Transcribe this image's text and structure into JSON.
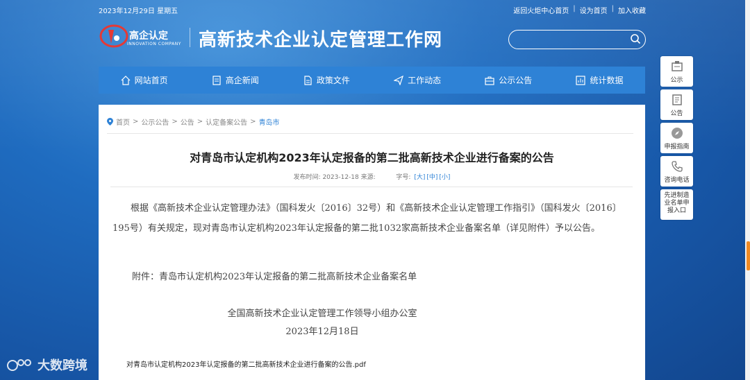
{
  "topbar": {
    "date": "2023年12月29日 星期五",
    "links": [
      "返回火炬中心首页",
      "设为首页",
      "加入收藏"
    ]
  },
  "logo": {
    "text": "高企认定",
    "sub": "INNOVATION COMPANY"
  },
  "site_title": "高新技术企业认定管理工作网",
  "search": {
    "placeholder": "",
    "icon": "search-icon"
  },
  "nav": [
    {
      "label": "网站首页",
      "icon": "home-icon"
    },
    {
      "label": "高企新闻",
      "icon": "news-icon"
    },
    {
      "label": "政策文件",
      "icon": "document-icon"
    },
    {
      "label": "工作动态",
      "icon": "send-icon"
    },
    {
      "label": "公示公告",
      "icon": "briefcase-icon"
    },
    {
      "label": "统计数据",
      "icon": "chart-icon"
    }
  ],
  "breadcrumb": [
    "首页",
    "公示公告",
    "公告",
    "认定备案公告",
    "青岛市"
  ],
  "article": {
    "title": "对青岛市认定机构2023年认定报备的第二批高新技术企业进行备案的公告",
    "meta_date_label": "发布时间: 2023-12-18 来源:",
    "meta_font_label": "字号:",
    "font_sizes": [
      "[大]",
      "[中]",
      "[小]"
    ],
    "body": "根据《高新技术企业认定管理办法》（国科发火〔2016〕32号）和《高新技术企业认定管理工作指引》（国科发火〔2016〕195号）有关规定，现对青岛市认定机构2023年认定报备的第二批1032家高新技术企业备案名单（详见附件）予以公告。",
    "attachment": "附件：青岛市认定机构2023年认定报备的第二批高新技术企业备案名单",
    "signature": "全国高新技术企业认定管理工作领导小组办公室",
    "sign_date": "2023年12月18日",
    "pdf": "对青岛市认定机构2023年认定报备的第二批高新技术企业进行备案的公告.pdf"
  },
  "side": [
    {
      "label": "公示",
      "icon": "notice-icon"
    },
    {
      "label": "公告",
      "icon": "announcement-icon"
    },
    {
      "label": "申报指南",
      "icon": "compass-icon"
    },
    {
      "label": "咨询电话",
      "icon": "phone-icon"
    },
    {
      "label": "先进制造业名单申报入口",
      "lines": [
        "先进制造",
        "业名单申",
        "报入口"
      ]
    }
  ],
  "watermark": "大数跨境",
  "colors": {
    "nav": "#2e82d6",
    "accent": "#2e82d6",
    "scroll": "#f08a24"
  }
}
